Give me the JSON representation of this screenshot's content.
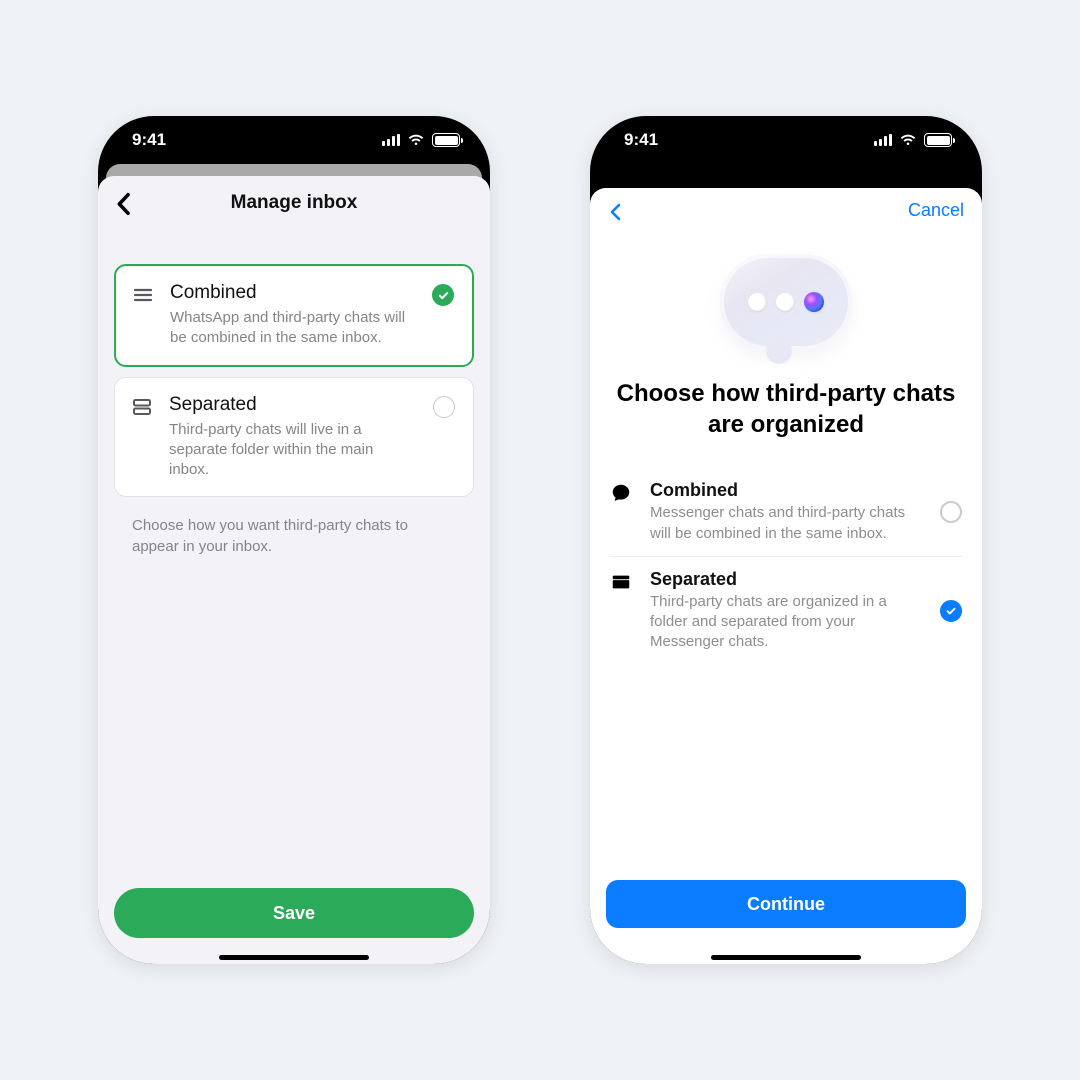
{
  "status": {
    "time": "9:41"
  },
  "phoneA": {
    "title": "Manage inbox",
    "options": [
      {
        "title": "Combined",
        "desc": "WhatsApp and third-party chats will be combined in the same inbox.",
        "selected": true
      },
      {
        "title": "Separated",
        "desc": "Third-party chats will live in a separate folder within the main inbox.",
        "selected": false
      }
    ],
    "help": "Choose how you want third-party chats to appear in your inbox.",
    "save": "Save"
  },
  "phoneB": {
    "cancel": "Cancel",
    "headline": "Choose how third-party chats are organized",
    "options": [
      {
        "title": "Combined",
        "desc": "Messenger chats and third-party chats will be combined in the same inbox.",
        "selected": false
      },
      {
        "title": "Separated",
        "desc": "Third-party chats are organized in a folder and separated from your Messenger chats.",
        "selected": true
      }
    ],
    "continue": "Continue"
  },
  "colors": {
    "whatsapp_green": "#2bab5a",
    "messenger_blue": "#0a7cff"
  }
}
